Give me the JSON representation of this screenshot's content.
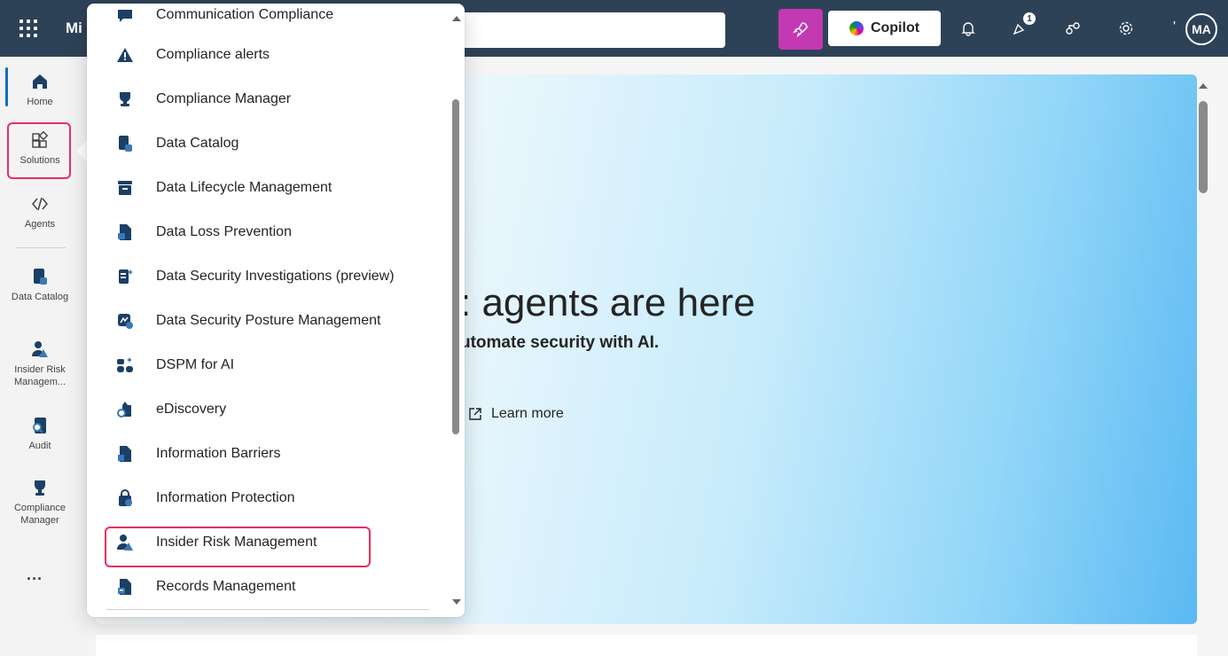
{
  "header": {
    "brand": "Mi",
    "copilot_label": "Copilot",
    "notification_count": "1",
    "avatar_initials": "MA",
    "tick": "'"
  },
  "rail": {
    "items": [
      {
        "label": "Home",
        "icon": "home-icon"
      },
      {
        "label": "Solutions",
        "icon": "solutions-icon"
      },
      {
        "label": "Agents",
        "icon": "agents-icon"
      },
      {
        "label": "Data Catalog",
        "icon": "data-catalog-icon"
      },
      {
        "label": "Insider Risk Managem...",
        "icon": "insider-risk-icon"
      },
      {
        "label": "Audit",
        "icon": "audit-icon"
      },
      {
        "label": "Compliance Manager",
        "icon": "compliance-manager-icon"
      }
    ],
    "more": "..."
  },
  "flyout": {
    "items": [
      {
        "label": "Communication Compliance",
        "icon": "communication-compliance-icon"
      },
      {
        "label": "Compliance alerts",
        "icon": "alert-icon"
      },
      {
        "label": "Compliance Manager",
        "icon": "trophy-icon"
      },
      {
        "label": "Data Catalog",
        "icon": "data-catalog-icon"
      },
      {
        "label": "Data Lifecycle Management",
        "icon": "archive-icon"
      },
      {
        "label": "Data Loss Prevention",
        "icon": "lock-document-icon"
      },
      {
        "label": "Data Security Investigations (preview)",
        "icon": "investigation-icon"
      },
      {
        "label": "Data Security Posture Management",
        "icon": "posture-icon"
      },
      {
        "label": "DSPM for AI",
        "icon": "dspm-ai-icon"
      },
      {
        "label": "eDiscovery",
        "icon": "ediscovery-icon"
      },
      {
        "label": "Information Barriers",
        "icon": "barrier-icon"
      },
      {
        "label": "Information Protection",
        "icon": "protection-icon"
      },
      {
        "label": "Insider Risk Management",
        "icon": "insider-risk-icon"
      },
      {
        "label": "Records Management",
        "icon": "records-icon"
      }
    ]
  },
  "hero": {
    "title": ": agents are here",
    "subtitle": "utomate security with AI.",
    "learn_more": "Learn more"
  },
  "colors": {
    "topbar": "#2e4257",
    "accent": "#0f6cbd",
    "highlight": "#e6305f",
    "rocket": "#c239b3"
  }
}
